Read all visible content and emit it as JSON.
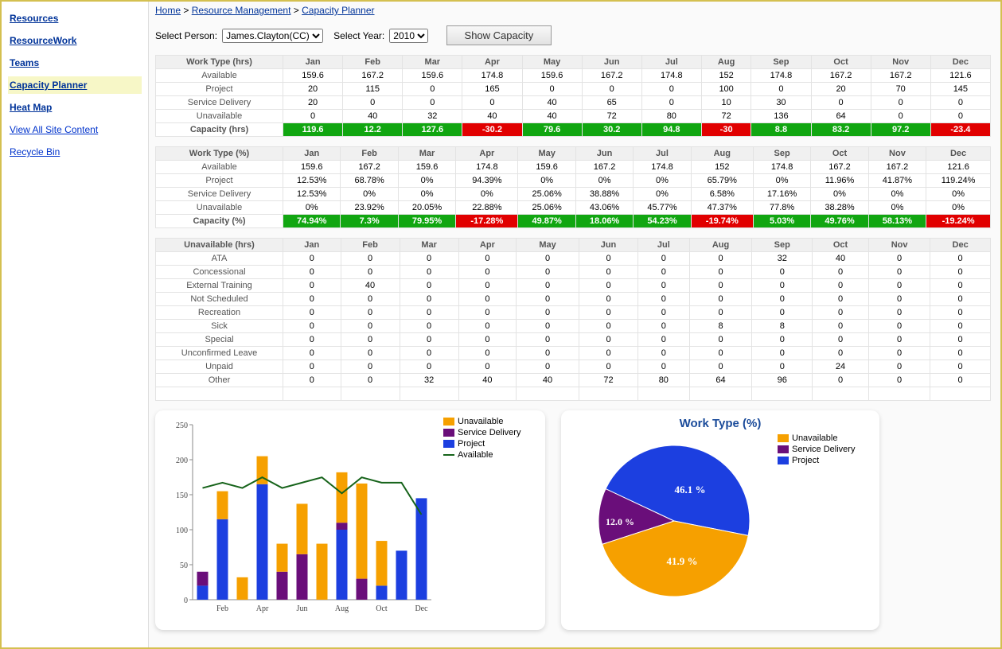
{
  "breadcrumb": {
    "home": "Home",
    "rm": "Resource Management",
    "cp": "Capacity Planner"
  },
  "sidebar": {
    "items": [
      {
        "label": "Resources"
      },
      {
        "label": "ResourceWork"
      },
      {
        "label": "Teams"
      },
      {
        "label": "Capacity Planner"
      },
      {
        "label": "Heat Map"
      },
      {
        "label": "View All Site Content"
      },
      {
        "label": "Recycle Bin"
      }
    ]
  },
  "controls": {
    "person_label": "Select Person:",
    "person_value": "James.Clayton(CC)",
    "year_label": "Select Year:",
    "year_value": "2010",
    "button": "Show Capacity"
  },
  "months": [
    "Jan",
    "Feb",
    "Mar",
    "Apr",
    "May",
    "Jun",
    "Jul",
    "Aug",
    "Sep",
    "Oct",
    "Nov",
    "Dec"
  ],
  "tableA": {
    "header": "Work Type (hrs)",
    "rows": [
      {
        "label": "Available",
        "vals": [
          "159.6",
          "167.2",
          "159.6",
          "174.8",
          "159.6",
          "167.2",
          "174.8",
          "152",
          "174.8",
          "167.2",
          "167.2",
          "121.6"
        ]
      },
      {
        "label": "Project",
        "vals": [
          "20",
          "115",
          "0",
          "165",
          "0",
          "0",
          "0",
          "100",
          "0",
          "20",
          "70",
          "145"
        ]
      },
      {
        "label": "Service Delivery",
        "vals": [
          "20",
          "0",
          "0",
          "0",
          "40",
          "65",
          "0",
          "10",
          "30",
          "0",
          "0",
          "0"
        ]
      },
      {
        "label": "Unavailable",
        "vals": [
          "0",
          "40",
          "32",
          "40",
          "40",
          "72",
          "80",
          "72",
          "136",
          "64",
          "0",
          "0"
        ]
      }
    ],
    "capacity": {
      "label": "Capacity (hrs)",
      "vals": [
        "119.6",
        "12.2",
        "127.6",
        "-30.2",
        "79.6",
        "30.2",
        "94.8",
        "-30",
        "8.8",
        "83.2",
        "97.2",
        "-23.4"
      ]
    }
  },
  "tableB": {
    "header": "Work Type (%)",
    "rows": [
      {
        "label": "Available",
        "vals": [
          "159.6",
          "167.2",
          "159.6",
          "174.8",
          "159.6",
          "167.2",
          "174.8",
          "152",
          "174.8",
          "167.2",
          "167.2",
          "121.6"
        ]
      },
      {
        "label": "Project",
        "vals": [
          "12.53%",
          "68.78%",
          "0%",
          "94.39%",
          "0%",
          "0%",
          "0%",
          "65.79%",
          "0%",
          "11.96%",
          "41.87%",
          "119.24%"
        ]
      },
      {
        "label": "Service Delivery",
        "vals": [
          "12.53%",
          "0%",
          "0%",
          "0%",
          "25.06%",
          "38.88%",
          "0%",
          "6.58%",
          "17.16%",
          "0%",
          "0%",
          "0%"
        ]
      },
      {
        "label": "Unavailable",
        "vals": [
          "0%",
          "23.92%",
          "20.05%",
          "22.88%",
          "25.06%",
          "43.06%",
          "45.77%",
          "47.37%",
          "77.8%",
          "38.28%",
          "0%",
          "0%"
        ]
      }
    ],
    "capacity": {
      "label": "Capacity (%)",
      "vals": [
        "74.94%",
        "7.3%",
        "79.95%",
        "-17.28%",
        "49.87%",
        "18.06%",
        "54.23%",
        "-19.74%",
        "5.03%",
        "49.76%",
        "58.13%",
        "-19.24%"
      ]
    }
  },
  "tableC": {
    "header": "Unavailable (hrs)",
    "rows": [
      {
        "label": "ATA",
        "vals": [
          "0",
          "0",
          "0",
          "0",
          "0",
          "0",
          "0",
          "0",
          "32",
          "40",
          "0",
          "0"
        ]
      },
      {
        "label": "Concessional",
        "vals": [
          "0",
          "0",
          "0",
          "0",
          "0",
          "0",
          "0",
          "0",
          "0",
          "0",
          "0",
          "0"
        ]
      },
      {
        "label": "External Training",
        "vals": [
          "0",
          "40",
          "0",
          "0",
          "0",
          "0",
          "0",
          "0",
          "0",
          "0",
          "0",
          "0"
        ]
      },
      {
        "label": "Not Scheduled",
        "vals": [
          "0",
          "0",
          "0",
          "0",
          "0",
          "0",
          "0",
          "0",
          "0",
          "0",
          "0",
          "0"
        ]
      },
      {
        "label": "Recreation",
        "vals": [
          "0",
          "0",
          "0",
          "0",
          "0",
          "0",
          "0",
          "0",
          "0",
          "0",
          "0",
          "0"
        ]
      },
      {
        "label": "Sick",
        "vals": [
          "0",
          "0",
          "0",
          "0",
          "0",
          "0",
          "0",
          "8",
          "8",
          "0",
          "0",
          "0"
        ]
      },
      {
        "label": "Special",
        "vals": [
          "0",
          "0",
          "0",
          "0",
          "0",
          "0",
          "0",
          "0",
          "0",
          "0",
          "0",
          "0"
        ]
      },
      {
        "label": "Unconfirmed Leave",
        "vals": [
          "0",
          "0",
          "0",
          "0",
          "0",
          "0",
          "0",
          "0",
          "0",
          "0",
          "0",
          "0"
        ]
      },
      {
        "label": "Unpaid",
        "vals": [
          "0",
          "0",
          "0",
          "0",
          "0",
          "0",
          "0",
          "0",
          "0",
          "24",
          "0",
          "0"
        ]
      },
      {
        "label": "Other",
        "vals": [
          "0",
          "0",
          "32",
          "40",
          "40",
          "72",
          "80",
          "64",
          "96",
          "0",
          "0",
          "0"
        ]
      }
    ]
  },
  "chart_data": [
    {
      "type": "bar",
      "title": "",
      "categories": [
        "Jan",
        "Feb",
        "Mar",
        "Apr",
        "May",
        "Jun",
        "Jul",
        "Aug",
        "Sep",
        "Oct",
        "Nov",
        "Dec"
      ],
      "x_tick_labels": [
        "Feb",
        "Apr",
        "Jun",
        "Aug",
        "Oct",
        "Dec"
      ],
      "series": [
        {
          "name": "Unavailable",
          "type": "bar",
          "color": "#f6a000",
          "values": [
            0,
            40,
            32,
            40,
            40,
            72,
            80,
            72,
            136,
            64,
            0,
            0
          ]
        },
        {
          "name": "Service Delivery",
          "type": "bar",
          "color": "#6a0e7a",
          "values": [
            20,
            0,
            0,
            0,
            40,
            65,
            0,
            10,
            30,
            0,
            0,
            0
          ]
        },
        {
          "name": "Project",
          "type": "bar",
          "color": "#1c3fe0",
          "values": [
            20,
            115,
            0,
            165,
            0,
            0,
            0,
            100,
            0,
            20,
            70,
            145
          ]
        },
        {
          "name": "Available",
          "type": "line",
          "color": "#16631a",
          "values": [
            159.6,
            167.2,
            159.6,
            174.8,
            159.6,
            167.2,
            174.8,
            152,
            174.8,
            167.2,
            167.2,
            121.6
          ]
        }
      ],
      "ylabel": "",
      "xlabel": "",
      "ylim": [
        0,
        250
      ],
      "legend_position": "right"
    },
    {
      "type": "pie",
      "title": "Work Type (%)",
      "series": [
        {
          "name": "Unavailable",
          "color": "#f6a000",
          "value": 41.9
        },
        {
          "name": "Service Delivery",
          "color": "#6a0e7a",
          "value": 12.0
        },
        {
          "name": "Project",
          "color": "#1c3fe0",
          "value": 46.1
        }
      ],
      "legend_position": "right"
    }
  ],
  "legend": {
    "unavailable": "Unavailable",
    "service_delivery": "Service Delivery",
    "project": "Project",
    "available": "Available"
  },
  "pie": {
    "title": "Work Type (%)",
    "label_proj": "46.1 %",
    "label_sd": "12.0 %",
    "label_unavail": "41.9 %"
  }
}
